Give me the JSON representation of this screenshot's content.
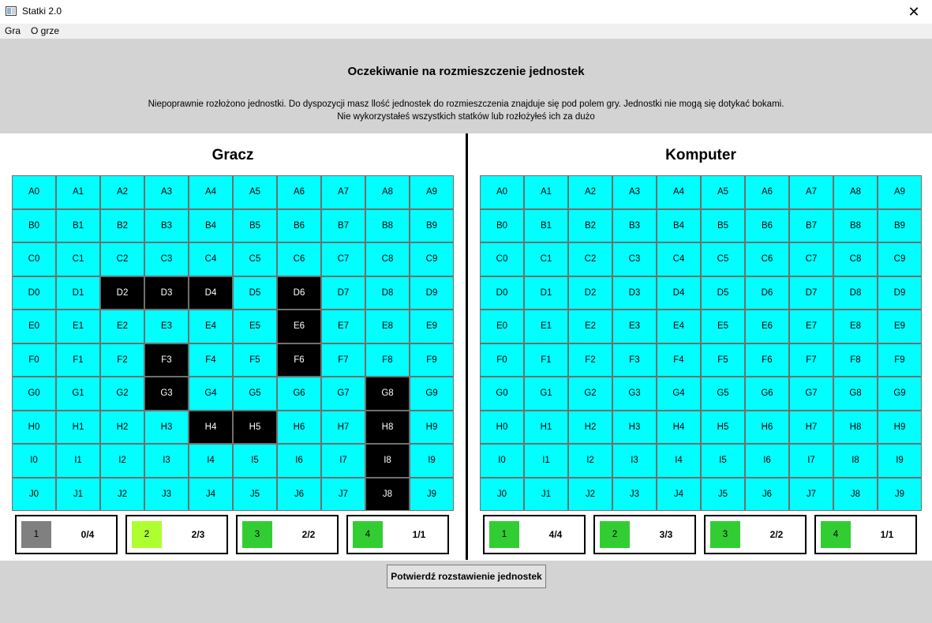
{
  "window": {
    "title": "Statki 2.0",
    "close_glyph": "✕"
  },
  "menu": {
    "items": [
      "Gra",
      "O grze"
    ]
  },
  "header": {
    "title": "Oczekiwanie na rozmieszczenie jednostek",
    "message_line1": "Niepoprawnie rozłożono jednostki. Do dyspozycji masz llość jednostek  do rozmieszczenia znajduje się pod polem gry. Jednostki nie mogą się dotykać bokami.",
    "message_line2": "Nie wykorzystałeś wszystkich statków lub rozłożyłeś ich za dużo"
  },
  "colors": {
    "water": "#00ffff",
    "ship": "#000000",
    "header_bg": "#d3d3d3",
    "swatch_gray": "#808080",
    "swatch_lime": "#adff2f",
    "swatch_green": "#32cd32"
  },
  "boards": {
    "player": {
      "title": "Gracz",
      "rows": [
        "A",
        "B",
        "C",
        "D",
        "E",
        "F",
        "G",
        "H",
        "I",
        "J"
      ],
      "cols": [
        "0",
        "1",
        "2",
        "3",
        "4",
        "5",
        "6",
        "7",
        "8",
        "9"
      ],
      "ships": [
        "D2",
        "D3",
        "D4",
        "D6",
        "E6",
        "F3",
        "F6",
        "G3",
        "G8",
        "H4",
        "H5",
        "H8",
        "I8",
        "J8"
      ],
      "counters": [
        {
          "size": "1",
          "value": "0/4",
          "color": "#808080"
        },
        {
          "size": "2",
          "value": "2/3",
          "color": "#adff2f"
        },
        {
          "size": "3",
          "value": "2/2",
          "color": "#32cd32"
        },
        {
          "size": "4",
          "value": "1/1",
          "color": "#32cd32"
        }
      ]
    },
    "computer": {
      "title": "Komputer",
      "rows": [
        "A",
        "B",
        "C",
        "D",
        "E",
        "F",
        "G",
        "H",
        "I",
        "J"
      ],
      "cols": [
        "0",
        "1",
        "2",
        "3",
        "4",
        "5",
        "6",
        "7",
        "8",
        "9"
      ],
      "ships": [],
      "counters": [
        {
          "size": "1",
          "value": "4/4",
          "color": "#32cd32"
        },
        {
          "size": "2",
          "value": "3/3",
          "color": "#32cd32"
        },
        {
          "size": "3",
          "value": "2/2",
          "color": "#32cd32"
        },
        {
          "size": "4",
          "value": "1/1",
          "color": "#32cd32"
        }
      ]
    }
  },
  "footer": {
    "confirm_label": "Potwierdź rozstawienie jednostek"
  }
}
